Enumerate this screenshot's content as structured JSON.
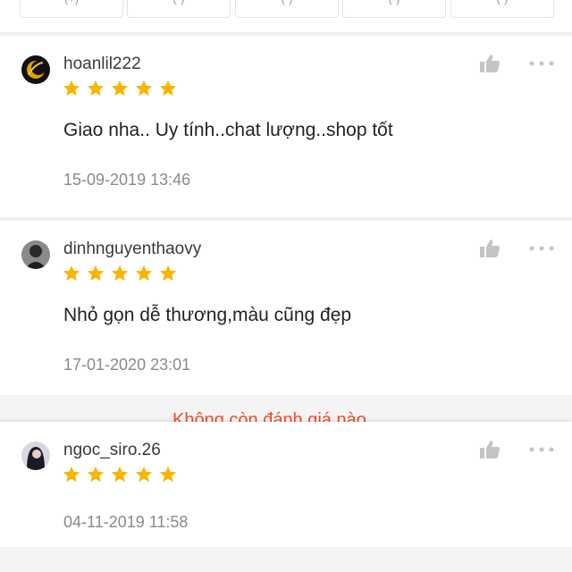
{
  "filters": [
    {
      "label": "(+)"
    },
    {
      "label": "(-)"
    },
    {
      "label": "(-)"
    },
    {
      "label": "(-)"
    },
    {
      "label": "(-)"
    }
  ],
  "reviews": [
    {
      "username": "hoanlil222",
      "rating": 5,
      "comment": "Giao nha.. Uy tính..chat lượng..shop tốt",
      "timestamp": "15-09-2019 13:46"
    },
    {
      "username": "dinhnguyenthaovy",
      "rating": 5,
      "comment": "Nhỏ gọn dễ thương,màu cũng đẹp",
      "timestamp": "17-01-2020 23:01"
    },
    {
      "username": "ngoc_siro.26",
      "rating": 5,
      "timestamp": "04-11-2019 11:58"
    }
  ],
  "notice": {
    "text": "Không còn đánh giá nào"
  },
  "icons": {
    "like": "thumbs-up-icon",
    "more": "more-dots-icon",
    "star": "star-icon"
  },
  "colors": {
    "star": "#f7b500",
    "icon": "#c4c4c4",
    "notice": "#ee4d2d",
    "divider": "#eeeeee"
  }
}
